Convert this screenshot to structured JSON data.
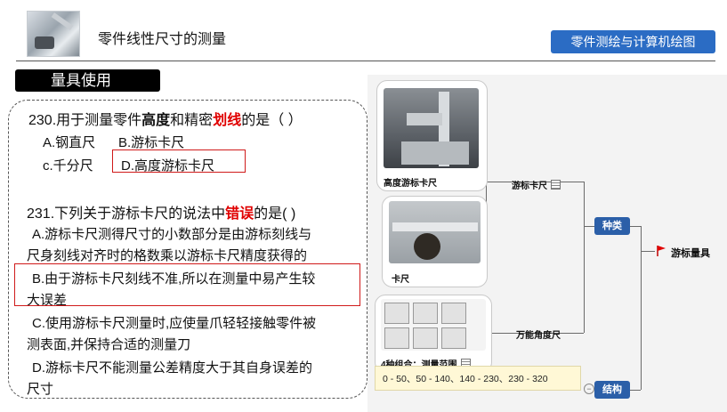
{
  "header": {
    "title": "零件线性尺寸的测量",
    "course_badge": "零件测绘与计算机绘图"
  },
  "section_tag": "量具使用",
  "q230": {
    "prefix": "230.用于测量零件",
    "bold1": "高度",
    "mid": "和精密",
    "red1": "划线",
    "suffix": "的是（  ）",
    "opt_a": "A.钢直尺",
    "opt_b": "B.游标卡尺",
    "opt_c": "c.千分尺",
    "opt_d": "D.高度游标卡尺"
  },
  "q231": {
    "prefix": "231.下列关于游标卡尺的说法中",
    "red1": "错误",
    "suffix": "的是(  )",
    "opt_a_l1": "A.游标卡尺测得尺寸的小数部分是由游标刻线与",
    "opt_a_l2": "尺身刻线对齐时的格数乘以游标卡尺精度获得的",
    "opt_b_l1": "B.由于游标卡尺刻线不准,所以在测量中易产生较",
    "opt_b_l2": "大误差",
    "opt_c_l1": "C.使用游标卡尺测量时,应使量爪轻轻接触零件被",
    "opt_c_l2": "测表面,并保持合适的测量刀",
    "opt_d_l1": "D.游标卡尺不能测量公差精度大于其自身误差的",
    "opt_d_l2": "尺寸"
  },
  "mindmap": {
    "card_height_gauge": "高度游标卡尺",
    "card_caliper": "卡尺",
    "card_combo": "4种组合：测量范围",
    "node_vernier": "游标卡尺",
    "node_bevel": "万能角度尺",
    "node_types": "种类",
    "node_structure": "结构",
    "root": "游标量具",
    "tooltip": "0 - 50、50 - 140、140 - 230、230 - 320"
  },
  "colors": {
    "badge_blue": "#2b6cc4",
    "node_blue": "#2b5fa8",
    "highlight_red": "#e00000",
    "tooltip_bg": "#fff8d6"
  }
}
